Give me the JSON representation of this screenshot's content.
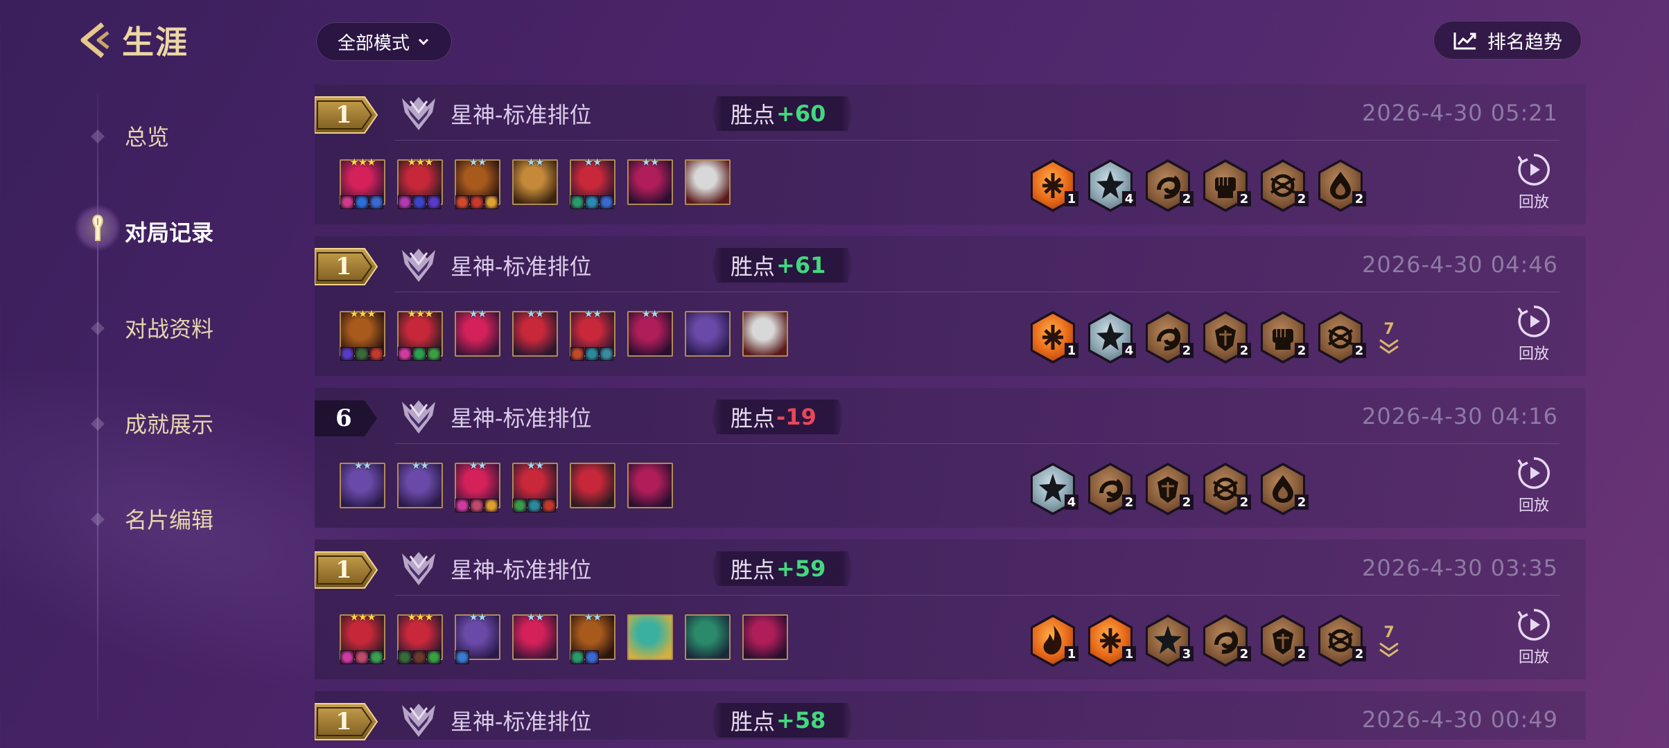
{
  "header": {
    "back_title": "生涯",
    "mode_select": "全部模式",
    "trend_button": "排名趋势"
  },
  "sidebar": {
    "items": [
      {
        "label": "总览",
        "active": false
      },
      {
        "label": "对局记录",
        "active": true
      },
      {
        "label": "对战资料",
        "active": false
      },
      {
        "label": "成就展示",
        "active": false
      },
      {
        "label": "名片编辑",
        "active": false
      }
    ]
  },
  "replay_label": "回放",
  "lp_label": "胜点",
  "matches": [
    {
      "rank": "1",
      "mode": "星神-标准排位",
      "lp": "+60",
      "date": "2026-4-30  05:21",
      "units": [
        {
          "stars": "★★★",
          "tier": "gold",
          "colors": [
            "#d4215a",
            "#3b1538"
          ],
          "items": [
            "#d03a8a",
            "#2a6fd8",
            "#3a6ad0"
          ]
        },
        {
          "stars": "★★★",
          "tier": "gold",
          "colors": [
            "#c6283a",
            "#2b1b22"
          ],
          "items": [
            "#b03ab0",
            "#3a46c8",
            "#5a3ac8"
          ]
        },
        {
          "stars": "★★",
          "tier": "blue",
          "colors": [
            "#a85a1c",
            "#2a1410"
          ],
          "items": [
            "#d04a2a",
            "#c83a2a",
            "#e0a030"
          ]
        },
        {
          "stars": "★★",
          "tier": "blue",
          "colors": [
            "#c48a3a",
            "#3a2410"
          ],
          "items": []
        },
        {
          "stars": "★★",
          "tier": "blue",
          "colors": [
            "#c8283a",
            "#2a1830"
          ],
          "items": [
            "#2a9a6a",
            "#2a8ab0",
            "#3a6ad0"
          ]
        },
        {
          "stars": "★★",
          "tier": "blue",
          "colors": [
            "#b01e5a",
            "#2a0f30"
          ],
          "items": []
        },
        {
          "stars": "",
          "tier": "none",
          "colors": [
            "#d8d8d8",
            "#5a1a1a"
          ],
          "items": []
        }
      ],
      "traits": [
        {
          "icon": "sunburst-icon",
          "count": "1",
          "tier": "gold"
        },
        {
          "icon": "star-icon",
          "count": "4",
          "tier": "silver"
        },
        {
          "icon": "swirl-icon",
          "count": "2",
          "tier": "bronze"
        },
        {
          "icon": "fist-icon",
          "count": "2",
          "tier": "bronze"
        },
        {
          "icon": "orbit-icon",
          "count": "2",
          "tier": "bronze"
        },
        {
          "icon": "drop-icon",
          "count": "2",
          "tier": "bronze"
        }
      ],
      "more": ""
    },
    {
      "rank": "1",
      "mode": "星神-标准排位",
      "lp": "+61",
      "date": "2026-4-30  04:46",
      "units": [
        {
          "stars": "★★★",
          "tier": "gold",
          "colors": [
            "#a85a1c",
            "#2a1410"
          ],
          "items": [
            "#5a3ac8",
            "#3a6a3a",
            "#c03a2a"
          ]
        },
        {
          "stars": "★★★",
          "tier": "gold",
          "colors": [
            "#c6283a",
            "#2b1b22"
          ],
          "items": [
            "#d03aa0",
            "#2aa050",
            "#3aa040"
          ]
        },
        {
          "stars": "★★",
          "tier": "blue",
          "colors": [
            "#d4215a",
            "#3b1538"
          ],
          "items": []
        },
        {
          "stars": "★★",
          "tier": "blue",
          "colors": [
            "#c8283a",
            "#2a1830"
          ],
          "items": []
        },
        {
          "stars": "★★",
          "tier": "blue",
          "colors": [
            "#c8283a",
            "#2a1830"
          ],
          "items": [
            "#c04a2a",
            "#2a8a9a",
            "#3a8aa0"
          ]
        },
        {
          "stars": "★★",
          "tier": "blue",
          "colors": [
            "#b01e5a",
            "#2a0f30"
          ],
          "items": []
        },
        {
          "stars": "",
          "tier": "none",
          "colors": [
            "#6a4aa8",
            "#2a1a4a"
          ],
          "items": []
        },
        {
          "stars": "",
          "tier": "none",
          "colors": [
            "#d8d8d8",
            "#5a1a1a"
          ],
          "items": []
        }
      ],
      "traits": [
        {
          "icon": "sunburst-icon",
          "count": "1",
          "tier": "gold"
        },
        {
          "icon": "star-icon",
          "count": "4",
          "tier": "silver"
        },
        {
          "icon": "swirl-icon",
          "count": "2",
          "tier": "bronze"
        },
        {
          "icon": "shield-icon",
          "count": "2",
          "tier": "bronze"
        },
        {
          "icon": "fist-icon",
          "count": "2",
          "tier": "bronze"
        },
        {
          "icon": "orbit-icon",
          "count": "2",
          "tier": "bronze"
        }
      ],
      "more": "7"
    },
    {
      "rank": "6",
      "mode": "星神-标准排位",
      "lp": "-19",
      "date": "2026-4-30  04:16",
      "units": [
        {
          "stars": "★★",
          "tier": "blue",
          "colors": [
            "#6a4aa8",
            "#2a1a4a"
          ],
          "items": []
        },
        {
          "stars": "★★",
          "tier": "blue",
          "colors": [
            "#6a4aa8",
            "#2a1a4a"
          ],
          "items": []
        },
        {
          "stars": "★★",
          "tier": "blue",
          "colors": [
            "#d4215a",
            "#3b1538"
          ],
          "items": [
            "#d03aa0",
            "#c04a6a",
            "#e0a030"
          ]
        },
        {
          "stars": "★★",
          "tier": "blue",
          "colors": [
            "#c8283a",
            "#2a1830"
          ],
          "items": [
            "#3a9a4a",
            "#2a8a9a",
            "#c03a2a"
          ]
        },
        {
          "stars": "",
          "tier": "none",
          "colors": [
            "#c6283a",
            "#2b1b22"
          ],
          "items": []
        },
        {
          "stars": "",
          "tier": "none",
          "colors": [
            "#b01e5a",
            "#2a0f30"
          ],
          "items": []
        }
      ],
      "traits": [
        {
          "icon": "star-icon",
          "count": "4",
          "tier": "silver"
        },
        {
          "icon": "swirl-icon",
          "count": "2",
          "tier": "bronze"
        },
        {
          "icon": "shield-icon",
          "count": "2",
          "tier": "bronze"
        },
        {
          "icon": "orbit-icon",
          "count": "2",
          "tier": "bronze"
        },
        {
          "icon": "drop-icon",
          "count": "2",
          "tier": "bronze"
        }
      ],
      "more": ""
    },
    {
      "rank": "1",
      "mode": "星神-标准排位",
      "lp": "+59",
      "date": "2026-4-30  03:35",
      "units": [
        {
          "stars": "★★★",
          "tier": "gold",
          "colors": [
            "#c6283a",
            "#2b1b22"
          ],
          "items": [
            "#d03aa0",
            "#c04a6a",
            "#3aa050"
          ]
        },
        {
          "stars": "★★★",
          "tier": "gold",
          "colors": [
            "#c8283a",
            "#2a1830"
          ],
          "items": [
            "#3a6a3a",
            "#6a3a2a",
            "#3aa040"
          ]
        },
        {
          "stars": "★★",
          "tier": "blue",
          "colors": [
            "#6a4aa8",
            "#2a1a4a"
          ],
          "items": [
            "#3a7ad0"
          ]
        },
        {
          "stars": "★★",
          "tier": "blue",
          "colors": [
            "#d4215a",
            "#3b1538"
          ],
          "items": []
        },
        {
          "stars": "★★",
          "tier": "blue",
          "colors": [
            "#a85a1c",
            "#2a1410"
          ],
          "items": [
            "#2a9a6a",
            "#3a6ad0"
          ]
        },
        {
          "stars": "",
          "tier": "none",
          "colors": [
            "#3ab0a0",
            "#d0b040"
          ],
          "items": []
        },
        {
          "stars": "",
          "tier": "none",
          "colors": [
            "#2a8a6a",
            "#1a2a3a"
          ],
          "items": []
        },
        {
          "stars": "",
          "tier": "none",
          "colors": [
            "#b01e5a",
            "#2a0f30"
          ],
          "items": []
        }
      ],
      "traits": [
        {
          "icon": "flame-icon",
          "count": "1",
          "tier": "gold"
        },
        {
          "icon": "sunburst-icon",
          "count": "1",
          "tier": "gold"
        },
        {
          "icon": "star-icon",
          "count": "3",
          "tier": "bronze"
        },
        {
          "icon": "swirl-icon",
          "count": "2",
          "tier": "bronze"
        },
        {
          "icon": "shield-icon",
          "count": "2",
          "tier": "bronze"
        },
        {
          "icon": "orbit-icon",
          "count": "2",
          "tier": "bronze"
        }
      ],
      "more": "7"
    },
    {
      "rank": "1",
      "mode": "星神-标准排位",
      "lp": "+58",
      "date": "2026-4-30  00:49",
      "units": [],
      "traits": [],
      "more": ""
    }
  ]
}
